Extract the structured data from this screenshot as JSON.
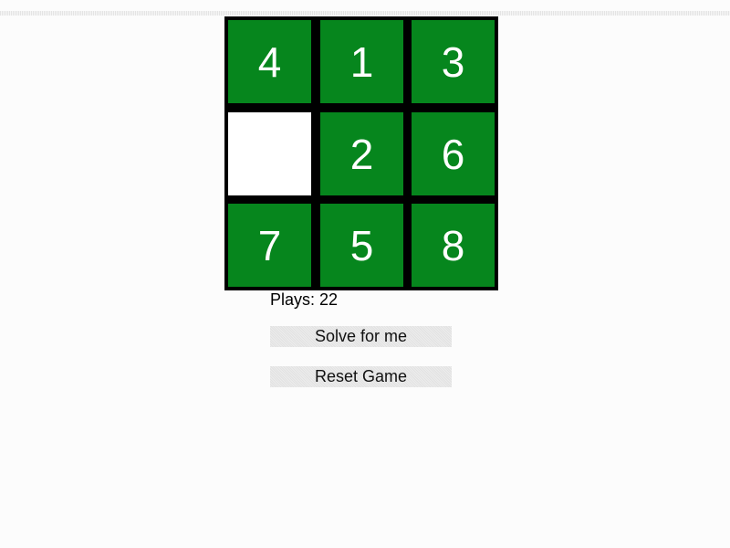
{
  "board": {
    "tiles": [
      "4",
      "1",
      "3",
      "",
      "2",
      "6",
      "7",
      "5",
      "8"
    ],
    "tile_color": "#06861d",
    "blank_color": "#ffffff",
    "grid_color": "#000000"
  },
  "status": {
    "plays_text": "Plays: 22"
  },
  "buttons": {
    "solve_label": "Solve for me",
    "reset_label": "Reset Game"
  }
}
